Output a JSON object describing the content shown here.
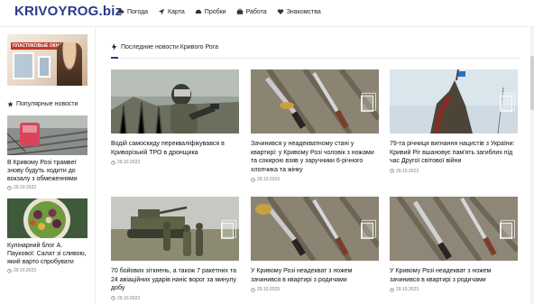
{
  "header": {
    "logo": "KRIVOYROG",
    "logo_tld": ".biz",
    "nav": [
      {
        "label": "Погода",
        "icon": "weather-icon"
      },
      {
        "label": "Карта",
        "icon": "map-arrow-icon"
      },
      {
        "label": "Пробки",
        "icon": "car-icon"
      },
      {
        "label": "Работа",
        "icon": "briefcase-icon"
      },
      {
        "label": "Знакомства",
        "icon": "heart-icon"
      }
    ]
  },
  "sidebar": {
    "ad_label": "ПЛАСТИКОВЫЕ ОКНА",
    "popular_title": "Популярные новости",
    "items": [
      {
        "title": "В Кривому Розі трамвеї знову будуть ходити до вокзалу з обмеженнями",
        "date": "29.10.2023"
      },
      {
        "title": "Кулінарний блог А. Паукової: Салат зі сливою, який варто спробувати",
        "date": "29.10.2023"
      }
    ]
  },
  "main": {
    "section_title": "Последние новости Кривого Рога",
    "cards": [
      {
        "title": "Водій самоскиду перекваліфікувався в Криворізькій ТРО в дронщика",
        "date": "29.10.2023"
      },
      {
        "title": "Зачинився у неадекватному стані у квартирі: у Кривому Розі чоловік з ножами та сокирою взяв у заручники 6-річного хлопчика та жінку",
        "date": "29.10.2023"
      },
      {
        "title": "79-та річниця вигнання нацистів з України: Кривий Ріг вшановує пам'ять загиблих під час Другої світової війни",
        "date": "29.10.2023"
      },
      {
        "title": "70 бойових зіткнень, а також 7 ракетних та 24 авіаційних ударів наніс ворог за минулу добу",
        "date": "29.10.2023"
      },
      {
        "title": "У Кривому Розі неадекват з ножем зачинився в квартирі з родичами",
        "date": "29.10.2023"
      },
      {
        "title": "У Кривому Розі неадекват з ножем зачинився в квартирі з родичами",
        "date": "29.10.2023"
      }
    ]
  },
  "colors": {
    "brand": "#2b3a8c",
    "date": "#7a7a7a"
  }
}
